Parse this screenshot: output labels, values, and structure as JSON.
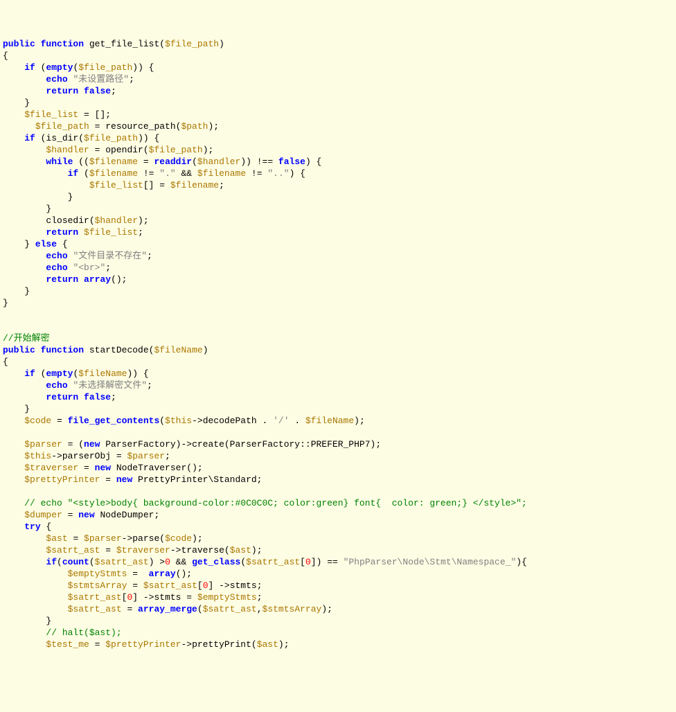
{
  "code": {
    "l1": {
      "t1": "public",
      "t2": "function",
      "t3": " get_file_list(",
      "t4": "$file_path",
      "t5": ")"
    },
    "l2": {
      "t1": "{"
    },
    "l3": {
      "t1": "    ",
      "t2": "if",
      "t3": " (",
      "t4": "empty",
      "t5": "(",
      "t6": "$file_path",
      "t7": ")) {"
    },
    "l4": {
      "t1": "        ",
      "t2": "echo",
      "t3": " ",
      "t4": "\"未设置路径\"",
      "t5": ";"
    },
    "l5": {
      "t1": "        ",
      "t2": "return",
      "t3": " ",
      "t4": "false",
      "t5": ";"
    },
    "l6": {
      "t1": "    }"
    },
    "l7": {
      "t1": "    ",
      "t2": "$file_list",
      "t3": " = [];"
    },
    "l8": {
      "t1": "      ",
      "t2": "$file_path",
      "t3": " = resource_path(",
      "t4": "$path",
      "t5": ");"
    },
    "l9": {
      "t1": "    ",
      "t2": "if",
      "t3": " (is_dir(",
      "t4": "$file_path",
      "t5": ")) {"
    },
    "l10": {
      "t1": "        ",
      "t2": "$handler",
      "t3": " = opendir(",
      "t4": "$file_path",
      "t5": ");"
    },
    "l11": {
      "t1": "        ",
      "t2": "while",
      "t3": " ((",
      "t4": "$filename",
      "t5": " = ",
      "t6": "readdir",
      "t7": "(",
      "t8": "$handler",
      "t9": ")) !== ",
      "t10": "false",
      "t11": ") {"
    },
    "l12": {
      "t1": "            ",
      "t2": "if",
      "t3": " (",
      "t4": "$filename",
      "t5": " != ",
      "t6": "\".\"",
      "t7": " && ",
      "t8": "$filename",
      "t9": " != ",
      "t10": "\"..\"",
      "t11": ") {"
    },
    "l13": {
      "t1": "                ",
      "t2": "$file_list",
      "t3": "[] = ",
      "t4": "$filename",
      "t5": ";"
    },
    "l14": {
      "t1": "            }"
    },
    "l15": {
      "t1": "        }"
    },
    "l16": {
      "t1": "        closedir(",
      "t2": "$handler",
      "t3": ");"
    },
    "l17": {
      "t1": "        ",
      "t2": "return",
      "t3": " ",
      "t4": "$file_list",
      "t5": ";"
    },
    "l18": {
      "t1": "    } ",
      "t2": "else",
      "t3": " {"
    },
    "l19": {
      "t1": "        ",
      "t2": "echo",
      "t3": " ",
      "t4": "\"文件目录不存在\"",
      "t5": ";"
    },
    "l20": {
      "t1": "        ",
      "t2": "echo",
      "t3": " ",
      "t4": "\"<br>\"",
      "t5": ";"
    },
    "l21": {
      "t1": "        ",
      "t2": "return",
      "t3": " ",
      "t4": "array",
      "t5": "();"
    },
    "l22": {
      "t1": "    }"
    },
    "l23": {
      "t1": "}"
    },
    "l24": {
      "t1": ""
    },
    "l25": {
      "t1": ""
    },
    "l26": {
      "t1": "//开始解密"
    },
    "l27": {
      "t1": "public",
      "t2": " ",
      "t3": "function",
      "t4": " startDecode(",
      "t5": "$fileName",
      "t6": ")"
    },
    "l28": {
      "t1": "{"
    },
    "l29": {
      "t1": "    ",
      "t2": "if",
      "t3": " (",
      "t4": "empty",
      "t5": "(",
      "t6": "$fileName",
      "t7": ")) {"
    },
    "l30": {
      "t1": "        ",
      "t2": "echo",
      "t3": " ",
      "t4": "\"未选择解密文件\"",
      "t5": ";"
    },
    "l31": {
      "t1": "        ",
      "t2": "return",
      "t3": " ",
      "t4": "false",
      "t5": ";"
    },
    "l32": {
      "t1": "    }"
    },
    "l33": {
      "t1": "    ",
      "t2": "$code",
      "t3": " = ",
      "t4": "file_get_contents",
      "t5": "(",
      "t6": "$this",
      "t7": "->decodePath . ",
      "t8": "'/'",
      "t9": " . ",
      "t10": "$fileName",
      "t11": ");"
    },
    "l34": {
      "t1": ""
    },
    "l35": {
      "t1": "    ",
      "t2": "$parser",
      "t3": " = (",
      "t4": "new",
      "t5": " ParserFactory)->create(ParserFactory::PREFER_PHP7);"
    },
    "l36": {
      "t1": "    ",
      "t2": "$this",
      "t3": "->parserObj = ",
      "t4": "$parser",
      "t5": ";"
    },
    "l37": {
      "t1": "    ",
      "t2": "$traverser",
      "t3": " = ",
      "t4": "new",
      "t5": " NodeTraverser();"
    },
    "l38": {
      "t1": "    ",
      "t2": "$prettyPrinter",
      "t3": " = ",
      "t4": "new",
      "t5": " PrettyPrinter\\Standard;"
    },
    "l39": {
      "t1": ""
    },
    "l40": {
      "t1": "    ",
      "t2": "// echo \"<style>body{ background-color:#0C0C0C; color:green} font{  color: green;} </style>\";"
    },
    "l41": {
      "t1": "    ",
      "t2": "$dumper",
      "t3": " = ",
      "t4": "new",
      "t5": " NodeDumper;"
    },
    "l42": {
      "t1": "    ",
      "t2": "try",
      "t3": " {"
    },
    "l43": {
      "t1": "        ",
      "t2": "$ast",
      "t3": " = ",
      "t4": "$parser",
      "t5": "->parse(",
      "t6": "$code",
      "t7": ");"
    },
    "l44": {
      "t1": "        ",
      "t2": "$satrt_ast",
      "t3": " = ",
      "t4": "$traverser",
      "t5": "->traverse(",
      "t6": "$ast",
      "t7": ");"
    },
    "l45": {
      "t1": "        ",
      "t2": "if",
      "t3": "(",
      "t4": "count",
      "t5": "(",
      "t6": "$satrt_ast",
      "t7": ") >",
      "t8": "0",
      "t9": " && ",
      "t10": "get_class",
      "t11": "(",
      "t12": "$satrt_ast",
      "t13": "[",
      "t14": "0",
      "t15": "]) == ",
      "t16": "\"PhpParser\\Node\\Stmt\\Namespace_\"",
      "t17": "){"
    },
    "l46": {
      "t1": "            ",
      "t2": "$emptyStmts",
      "t3": " =  ",
      "t4": "array",
      "t5": "();"
    },
    "l47": {
      "t1": "            ",
      "t2": "$stmtsArray",
      "t3": " = ",
      "t4": "$satrt_ast",
      "t5": "[",
      "t6": "0",
      "t7": "] ->stmts;"
    },
    "l48": {
      "t1": "            ",
      "t2": "$satrt_ast",
      "t3": "[",
      "t4": "0",
      "t5": "] ->stmts = ",
      "t6": "$emptyStmts",
      "t7": ";"
    },
    "l49": {
      "t1": "            ",
      "t2": "$satrt_ast",
      "t3": " = ",
      "t4": "array_merge",
      "t5": "(",
      "t6": "$satrt_ast",
      "t7": ",",
      "t8": "$stmtsArray",
      "t9": ");"
    },
    "l50": {
      "t1": "        }"
    },
    "l51": {
      "t1": "        ",
      "t2": "// halt($ast);"
    },
    "l52": {
      "t1": "        ",
      "t2": "$test_me",
      "t3": " = ",
      "t4": "$prettyPrinter",
      "t5": "->prettyPrint(",
      "t6": "$ast",
      "t7": ");"
    }
  }
}
